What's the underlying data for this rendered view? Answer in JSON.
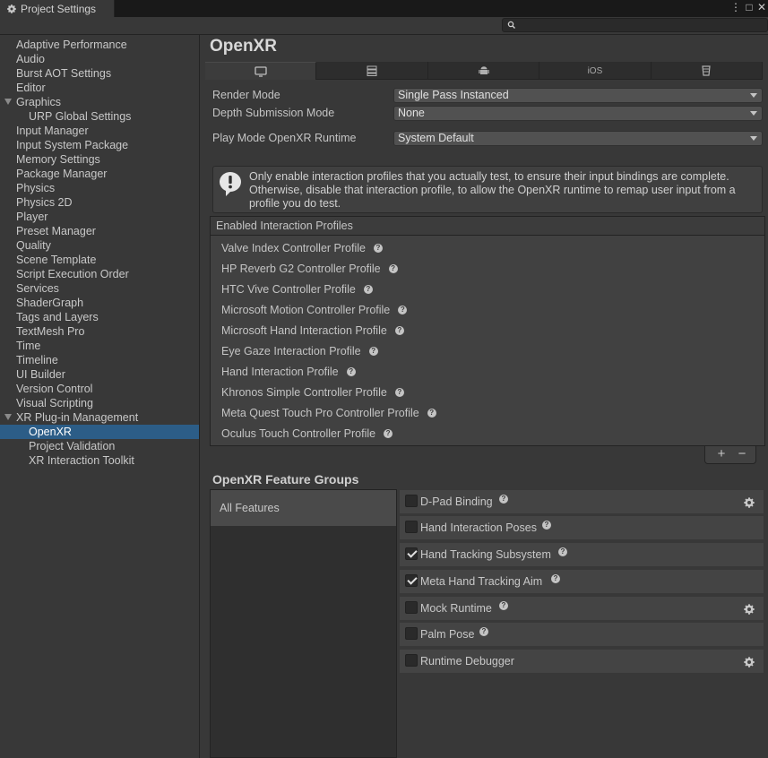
{
  "window": {
    "tab_title": "Project Settings",
    "menu_glyph": "⋮",
    "maximize_glyph": "□",
    "close_glyph": "✕"
  },
  "search": {
    "placeholder": ""
  },
  "nav": {
    "items": [
      {
        "label": "Adaptive Performance"
      },
      {
        "label": "Audio"
      },
      {
        "label": "Burst AOT Settings"
      },
      {
        "label": "Editor"
      },
      {
        "label": "Graphics"
      },
      {
        "label": "URP Global Settings"
      },
      {
        "label": "Input Manager"
      },
      {
        "label": "Input System Package"
      },
      {
        "label": "Memory Settings"
      },
      {
        "label": "Package Manager"
      },
      {
        "label": "Physics"
      },
      {
        "label": "Physics 2D"
      },
      {
        "label": "Player"
      },
      {
        "label": "Preset Manager"
      },
      {
        "label": "Quality"
      },
      {
        "label": "Scene Template"
      },
      {
        "label": "Script Execution Order"
      },
      {
        "label": "Services"
      },
      {
        "label": "ShaderGraph"
      },
      {
        "label": "Tags and Layers"
      },
      {
        "label": "TextMesh Pro"
      },
      {
        "label": "Time"
      },
      {
        "label": "Timeline"
      },
      {
        "label": "UI Builder"
      },
      {
        "label": "Version Control"
      },
      {
        "label": "Visual Scripting"
      },
      {
        "label": "XR Plug-in Management"
      },
      {
        "label": "OpenXR"
      },
      {
        "label": "Project Validation"
      },
      {
        "label": "XR Interaction Toolkit"
      }
    ]
  },
  "page": {
    "title": "OpenXR",
    "platform_tabs": [
      "desktop-icon",
      "server-icon",
      "android-icon",
      "iOS",
      "webgl-icon"
    ],
    "ios_label": "iOS",
    "render_mode": {
      "label": "Render Mode",
      "value": "Single Pass Instanced"
    },
    "depth_mode": {
      "label": "Depth Submission Mode",
      "value": "None"
    },
    "runtime": {
      "label": "Play Mode OpenXR Runtime",
      "value": "System Default"
    },
    "help_text": "Only enable interaction profiles that you actually test, to ensure their input bindings are complete. Otherwise, disable that interaction profile, to allow the OpenXR runtime to remap user input from a profile you do test.",
    "profiles_header": "Enabled Interaction Profiles",
    "profiles": [
      "Valve Index Controller Profile",
      "HP Reverb G2 Controller Profile",
      "HTC Vive Controller Profile",
      "Microsoft Motion Controller Profile",
      "Microsoft Hand Interaction Profile",
      "Eye Gaze Interaction Profile",
      "Hand Interaction Profile",
      "Khronos Simple Controller Profile",
      "Meta Quest Touch Pro Controller Profile",
      "Oculus Touch Controller Profile"
    ],
    "add_label": "+",
    "remove_label": "−",
    "feature_groups_title": "OpenXR Feature Groups",
    "feature_group": "All Features",
    "features": [
      {
        "name": "D-Pad Binding",
        "checked": false,
        "gear": true
      },
      {
        "name": "Hand Interaction Poses",
        "checked": false,
        "gear": false
      },
      {
        "name": "Hand Tracking Subsystem",
        "checked": true,
        "gear": false
      },
      {
        "name": "Meta Hand Tracking Aim",
        "checked": true,
        "gear": false
      },
      {
        "name": "Mock Runtime",
        "checked": false,
        "gear": true
      },
      {
        "name": "Palm Pose",
        "checked": false,
        "gear": false
      },
      {
        "name": "Runtime Debugger",
        "checked": false,
        "gear": true
      }
    ]
  },
  "colors": {
    "selection": "#2c5d87",
    "background": "#383838"
  }
}
